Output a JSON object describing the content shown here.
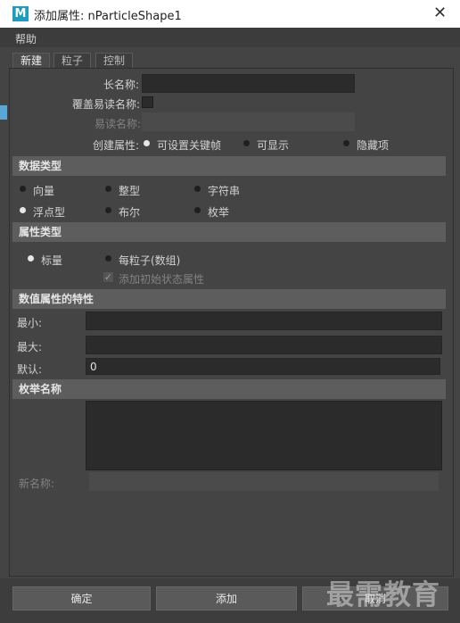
{
  "window": {
    "title": "添加属性: nParticleShape1",
    "app_icon_letter": "M"
  },
  "menu": {
    "help": "帮助"
  },
  "tabs": [
    "新建",
    "粒子",
    "控制"
  ],
  "names": {
    "long_name_label": "长名称:",
    "override_nice_label": "覆盖易读名称:",
    "nice_name_label": "易读名称:",
    "long_name_value": "",
    "nice_name_value": ""
  },
  "make_attribute": {
    "label": "创建属性:",
    "options": [
      "可设置关键帧",
      "可显示",
      "隐藏项"
    ],
    "selected": "可设置关键帧"
  },
  "data_type": {
    "title": "数据类型",
    "options": [
      "向量",
      "整型",
      "字符串",
      "浮点型",
      "布尔",
      "枚举"
    ],
    "selected": "浮点型"
  },
  "attribute_type": {
    "title": "属性类型",
    "options": [
      "标量",
      "每粒子(数组)"
    ],
    "selected": "标量",
    "initial_state_label": "添加初始状态属性"
  },
  "numeric": {
    "title": "数值属性的特性",
    "min_label": "最小:",
    "max_label": "最大:",
    "default_label": "默认:",
    "min_value": "",
    "max_value": "",
    "default_value": "0"
  },
  "enum": {
    "title": "枚举名称",
    "new_name_label": "新名称:"
  },
  "buttons": {
    "ok": "确定",
    "add": "添加",
    "cancel": "取消"
  },
  "watermark": "最需教育"
}
